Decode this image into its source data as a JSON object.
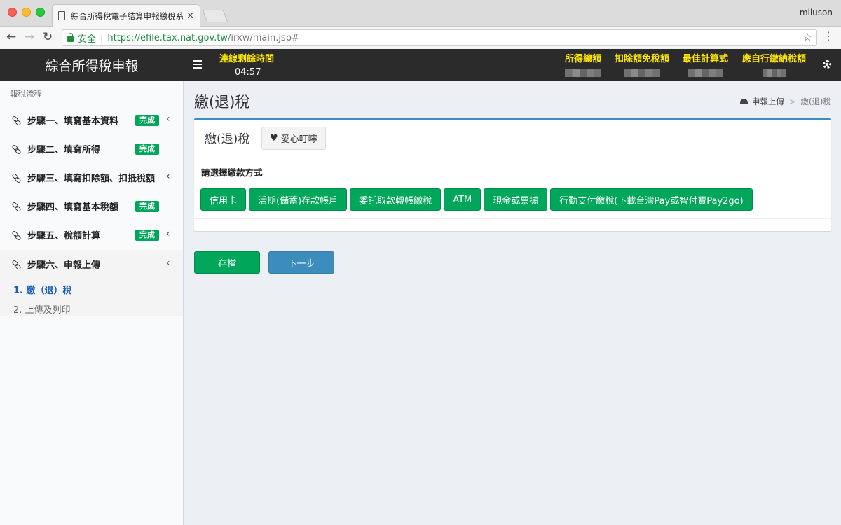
{
  "browser": {
    "tab_title": "綜合所得稅電子結算申報繳稅系統",
    "tab_close": "×",
    "profile_name": "miluson",
    "secure_label": "安全",
    "url_host": "https://efile.tax.nat.gov.tw",
    "url_path": "/irxw/main.jsp#"
  },
  "header": {
    "app_title": "綜合所得稅申報",
    "timer_label": "連線剩餘時間",
    "timer_value": "04:57",
    "stats": [
      "所得總額",
      "扣除額免稅額",
      "最佳計算式",
      "應自行繳納稅額"
    ]
  },
  "sidebar": {
    "section_title": "報稅流程",
    "steps": [
      {
        "label": "步驟一、填寫基本資料",
        "badge": "完成",
        "chevron": "‹"
      },
      {
        "label": "步驟二、填寫所得",
        "badge": "完成",
        "chevron": ""
      },
      {
        "label": "步驟三、填寫扣除額、扣抵稅額",
        "badge": "",
        "chevron": "‹"
      },
      {
        "label": "步驟四、填寫基本稅額",
        "badge": "完成",
        "chevron": ""
      },
      {
        "label": "步驟五、稅額計算",
        "badge": "完成",
        "chevron": "‹"
      },
      {
        "label": "步驟六、申報上傳",
        "badge": "",
        "chevron": "‹"
      }
    ],
    "sub_items": [
      "1. 繳（退）稅",
      "2. 上傳及列印"
    ]
  },
  "main": {
    "page_title": "繳(退)稅",
    "breadcrumb": {
      "home": "申報上傳",
      "sep": ">",
      "current": "繳(退)稅"
    },
    "box_title": "繳(退)稅",
    "love_button": "愛心叮嚀",
    "prompt": "請選擇繳款方式",
    "payment_methods": [
      "信用卡",
      "活期(儲蓄)存款帳戶",
      "委託取款轉帳繳稅",
      "ATM",
      "現金或票據",
      "行動支付繳稅(下載台灣Pay或智付寶Pay2go)"
    ],
    "save_button": "存檔",
    "next_button": "下一步"
  },
  "colors": {
    "header_bg": "#2b2b2b",
    "accent_yellow": "#ffe600",
    "success_green": "#00a65a",
    "primary_blue": "#3c8dbc",
    "active_link": "#1a5eb8"
  }
}
